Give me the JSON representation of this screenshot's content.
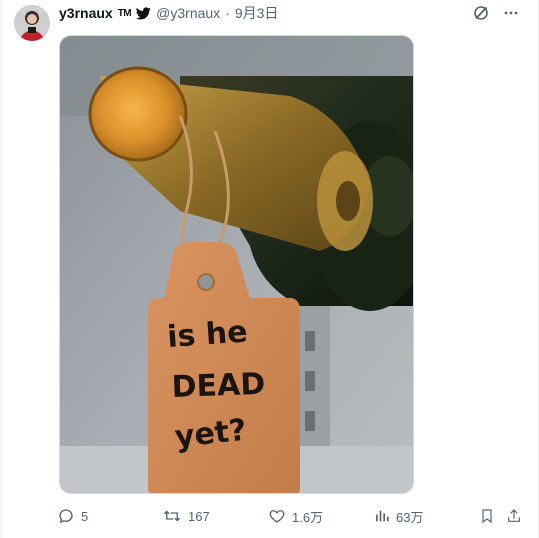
{
  "tweet": {
    "author": {
      "display_name": "y3rnaux",
      "badge": "TM",
      "handle": "@y3rnaux",
      "separator": "·",
      "date": "9月3日"
    },
    "media": {
      "tag_text_line1": "is he",
      "tag_text_line2": "DEAD",
      "tag_text_line3": "yet?"
    },
    "stats": {
      "replies": "5",
      "retweets": "167",
      "likes": "1.6万",
      "views": "63万"
    }
  },
  "icons": {
    "verified": "twitter-bird-icon",
    "grok": "grok-icon",
    "more": "more-icon",
    "reply": "reply-icon",
    "retweet": "retweet-icon",
    "like": "heart-icon",
    "views": "views-icon",
    "bookmark": "bookmark-icon",
    "share": "share-icon"
  },
  "colors": {
    "text_primary": "#0f1419",
    "text_secondary": "#536471",
    "twitter_blue": "#1d9bf0"
  }
}
